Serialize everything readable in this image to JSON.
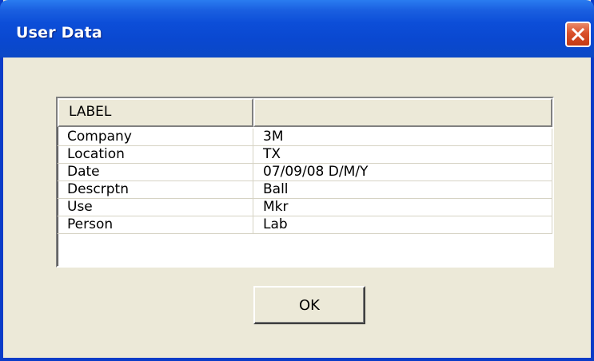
{
  "window": {
    "title": "User Data"
  },
  "grid": {
    "columns": [
      "LABEL",
      ""
    ],
    "rows": [
      {
        "label": "Company",
        "value": "3M"
      },
      {
        "label": "Location",
        "value": "TX"
      },
      {
        "label": "Date",
        "value": "07/09/08 D/M/Y"
      },
      {
        "label": "Descrptn",
        "value": "Ball"
      },
      {
        "label": "Use",
        "value": "Mkr"
      },
      {
        "label": "Person",
        "value": "Lab"
      }
    ]
  },
  "buttons": {
    "ok_label": "OK"
  },
  "colors": {
    "titlebar": "#0a48d0",
    "close_button": "#d9502a",
    "dialog_face": "#ece9d8"
  },
  "icons": {
    "close": "close-icon"
  }
}
